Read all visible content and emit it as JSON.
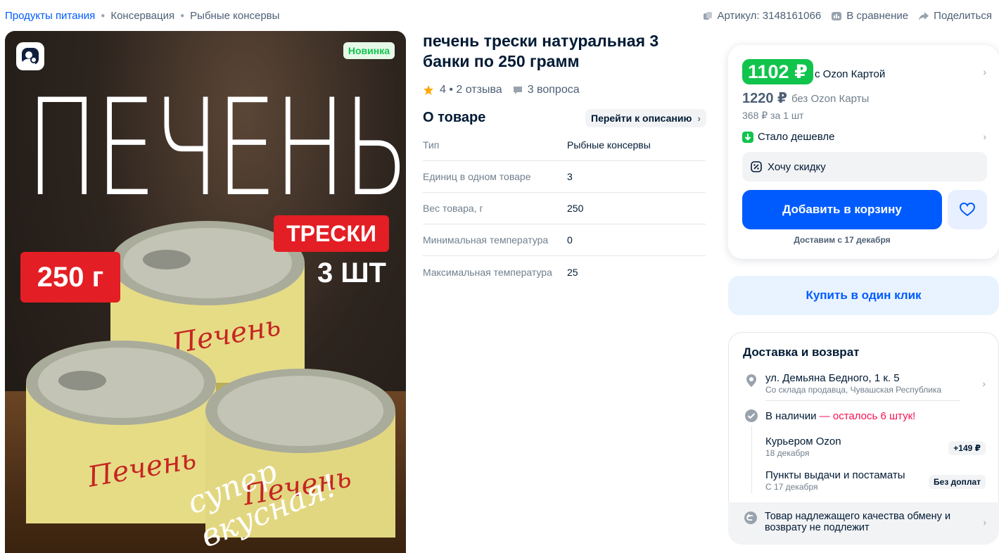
{
  "breadcrumb": {
    "items": [
      "Продукты питания",
      "Консервация",
      "Рыбные консервы"
    ]
  },
  "top_actions": {
    "article": "Артикул: 3148161066",
    "compare": "В сравнение",
    "share": "Поделиться"
  },
  "gallery": {
    "badge": "Новинка",
    "lens_icon": "image-search-icon",
    "image_text": {
      "big": "ПЕЧЕНЬ",
      "tag1": "ТРЕСКИ",
      "tag2": "250 г",
      "count": "3 ШТ",
      "script": "супер вкусная!"
    }
  },
  "product": {
    "title": "печень трески натуральная 3 банки по 250 грамм",
    "rating": "4",
    "reviews": "2 отзыва",
    "questions": "3 вопроса"
  },
  "about": {
    "heading": "О товаре",
    "goto": "Перейти к описанию",
    "specs": [
      {
        "k": "Тип",
        "v": "Рыбные консервы"
      },
      {
        "k": "Единиц в одном товаре",
        "v": "3"
      },
      {
        "k": "Вес товара, г",
        "v": "250"
      },
      {
        "k": "Минимальная температура",
        "v": "0"
      },
      {
        "k": "Максимальная температура",
        "v": "25"
      }
    ]
  },
  "pricing": {
    "card_price": "1102 ₽",
    "card_label": "с Ozon Картой",
    "regular_price": "1220 ₽",
    "regular_label": "без Ozon Карты",
    "unit_price": "368 ₽ за 1 шт",
    "cheaper": "Стало дешевле",
    "want_discount": "Хочу скидку",
    "add_to_cart": "Добавить в корзину",
    "delivery_from": "Доставим с 17 декабря",
    "buy_one_click": "Купить в один клик"
  },
  "delivery": {
    "title": "Доставка и возврат",
    "address": "ул. Демьяна Бедного, 1 к. 5",
    "address_sub": "Со склада продавца, Чувашская Республика",
    "stock": "В наличии",
    "stock_remain": " — осталось 6 штук!",
    "courier": "Курьером Ozon",
    "courier_date": "18 декабря",
    "courier_price": "+149 ₽",
    "pickup": "Пункты выдачи и постаматы",
    "pickup_date": "С 17 декабря",
    "pickup_price": "Без доплат",
    "return_text": "Товар надлежащего качества обмену и возврату не подлежит"
  },
  "colors": {
    "accent": "#005bff",
    "green": "#10c44c",
    "pink": "#f91155",
    "red_tag": "#e31e24"
  }
}
